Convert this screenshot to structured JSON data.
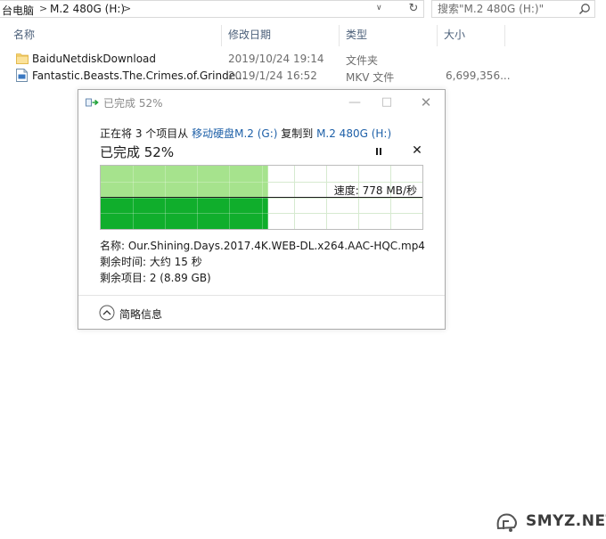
{
  "address_bar": {
    "crumbs": [
      "台电脑",
      "M.2 480G (H:)"
    ],
    "separator": ">",
    "search_placeholder": "搜索\"M.2 480G (H:)\""
  },
  "columns": {
    "name": "名称",
    "date": "修改日期",
    "type": "类型",
    "size": "大小"
  },
  "files": [
    {
      "name": "BaiduNetdiskDownload",
      "date": "2019/10/24 19:14",
      "type": "文件夹",
      "size": "",
      "icon": "folder-icon"
    },
    {
      "name": "Fantastic.Beasts.The.Crimes.of.Grinde...",
      "date": "2019/1/24 16:52",
      "type": "MKV 文件",
      "size": "6,699,356...",
      "icon": "video-file-icon"
    }
  ],
  "dialog": {
    "title": "已完成 52%",
    "line_prefix": "正在将 3 个项目从 ",
    "source": "移动硬盘M.2 (G:)",
    "line_mid": " 复制到 ",
    "destination": "M.2 480G (H:)",
    "status": "已完成 52%",
    "progress_percent": 52,
    "speed": "速度: 778 MB/秒",
    "name_label": "名称: Our.Shining.Days.2017.4K.WEB-DL.x264.AAC-HQC.mp4",
    "time_left": "剩余时间: 大约 15 秒",
    "items_left": "剩余项目: 2 (8.89 GB)",
    "details_toggle": "简略信息",
    "colors": {
      "chart_fill_light": "#a6e38d",
      "chart_fill_dark": "#10ae2c",
      "grid": "#d6ead0",
      "speed_line": "#1a1a1a"
    }
  },
  "watermark": {
    "text": "SMYZ.NET"
  }
}
